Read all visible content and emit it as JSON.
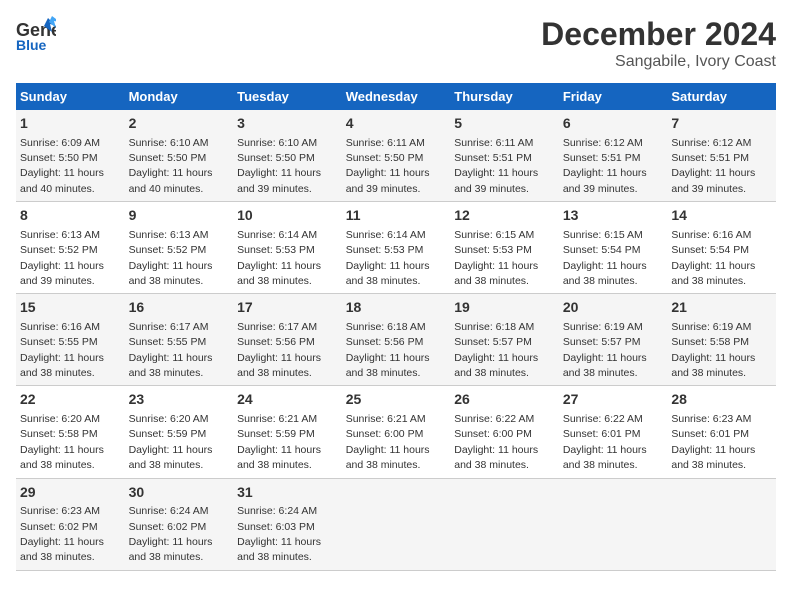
{
  "logo": {
    "line1": "General",
    "line2": "Blue"
  },
  "title": "December 2024",
  "subtitle": "Sangabile, Ivory Coast",
  "days_header": [
    "Sunday",
    "Monday",
    "Tuesday",
    "Wednesday",
    "Thursday",
    "Friday",
    "Saturday"
  ],
  "weeks": [
    [
      {
        "day": "1",
        "sunrise": "6:09 AM",
        "sunset": "5:50 PM",
        "daylight": "11 hours and 40 minutes."
      },
      {
        "day": "2",
        "sunrise": "6:10 AM",
        "sunset": "5:50 PM",
        "daylight": "11 hours and 40 minutes."
      },
      {
        "day": "3",
        "sunrise": "6:10 AM",
        "sunset": "5:50 PM",
        "daylight": "11 hours and 39 minutes."
      },
      {
        "day": "4",
        "sunrise": "6:11 AM",
        "sunset": "5:50 PM",
        "daylight": "11 hours and 39 minutes."
      },
      {
        "day": "5",
        "sunrise": "6:11 AM",
        "sunset": "5:51 PM",
        "daylight": "11 hours and 39 minutes."
      },
      {
        "day": "6",
        "sunrise": "6:12 AM",
        "sunset": "5:51 PM",
        "daylight": "11 hours and 39 minutes."
      },
      {
        "day": "7",
        "sunrise": "6:12 AM",
        "sunset": "5:51 PM",
        "daylight": "11 hours and 39 minutes."
      }
    ],
    [
      {
        "day": "8",
        "sunrise": "6:13 AM",
        "sunset": "5:52 PM",
        "daylight": "11 hours and 39 minutes."
      },
      {
        "day": "9",
        "sunrise": "6:13 AM",
        "sunset": "5:52 PM",
        "daylight": "11 hours and 38 minutes."
      },
      {
        "day": "10",
        "sunrise": "6:14 AM",
        "sunset": "5:53 PM",
        "daylight": "11 hours and 38 minutes."
      },
      {
        "day": "11",
        "sunrise": "6:14 AM",
        "sunset": "5:53 PM",
        "daylight": "11 hours and 38 minutes."
      },
      {
        "day": "12",
        "sunrise": "6:15 AM",
        "sunset": "5:53 PM",
        "daylight": "11 hours and 38 minutes."
      },
      {
        "day": "13",
        "sunrise": "6:15 AM",
        "sunset": "5:54 PM",
        "daylight": "11 hours and 38 minutes."
      },
      {
        "day": "14",
        "sunrise": "6:16 AM",
        "sunset": "5:54 PM",
        "daylight": "11 hours and 38 minutes."
      }
    ],
    [
      {
        "day": "15",
        "sunrise": "6:16 AM",
        "sunset": "5:55 PM",
        "daylight": "11 hours and 38 minutes."
      },
      {
        "day": "16",
        "sunrise": "6:17 AM",
        "sunset": "5:55 PM",
        "daylight": "11 hours and 38 minutes."
      },
      {
        "day": "17",
        "sunrise": "6:17 AM",
        "sunset": "5:56 PM",
        "daylight": "11 hours and 38 minutes."
      },
      {
        "day": "18",
        "sunrise": "6:18 AM",
        "sunset": "5:56 PM",
        "daylight": "11 hours and 38 minutes."
      },
      {
        "day": "19",
        "sunrise": "6:18 AM",
        "sunset": "5:57 PM",
        "daylight": "11 hours and 38 minutes."
      },
      {
        "day": "20",
        "sunrise": "6:19 AM",
        "sunset": "5:57 PM",
        "daylight": "11 hours and 38 minutes."
      },
      {
        "day": "21",
        "sunrise": "6:19 AM",
        "sunset": "5:58 PM",
        "daylight": "11 hours and 38 minutes."
      }
    ],
    [
      {
        "day": "22",
        "sunrise": "6:20 AM",
        "sunset": "5:58 PM",
        "daylight": "11 hours and 38 minutes."
      },
      {
        "day": "23",
        "sunrise": "6:20 AM",
        "sunset": "5:59 PM",
        "daylight": "11 hours and 38 minutes."
      },
      {
        "day": "24",
        "sunrise": "6:21 AM",
        "sunset": "5:59 PM",
        "daylight": "11 hours and 38 minutes."
      },
      {
        "day": "25",
        "sunrise": "6:21 AM",
        "sunset": "6:00 PM",
        "daylight": "11 hours and 38 minutes."
      },
      {
        "day": "26",
        "sunrise": "6:22 AM",
        "sunset": "6:00 PM",
        "daylight": "11 hours and 38 minutes."
      },
      {
        "day": "27",
        "sunrise": "6:22 AM",
        "sunset": "6:01 PM",
        "daylight": "11 hours and 38 minutes."
      },
      {
        "day": "28",
        "sunrise": "6:23 AM",
        "sunset": "6:01 PM",
        "daylight": "11 hours and 38 minutes."
      }
    ],
    [
      {
        "day": "29",
        "sunrise": "6:23 AM",
        "sunset": "6:02 PM",
        "daylight": "11 hours and 38 minutes."
      },
      {
        "day": "30",
        "sunrise": "6:24 AM",
        "sunset": "6:02 PM",
        "daylight": "11 hours and 38 minutes."
      },
      {
        "day": "31",
        "sunrise": "6:24 AM",
        "sunset": "6:03 PM",
        "daylight": "11 hours and 38 minutes."
      },
      null,
      null,
      null,
      null
    ]
  ]
}
